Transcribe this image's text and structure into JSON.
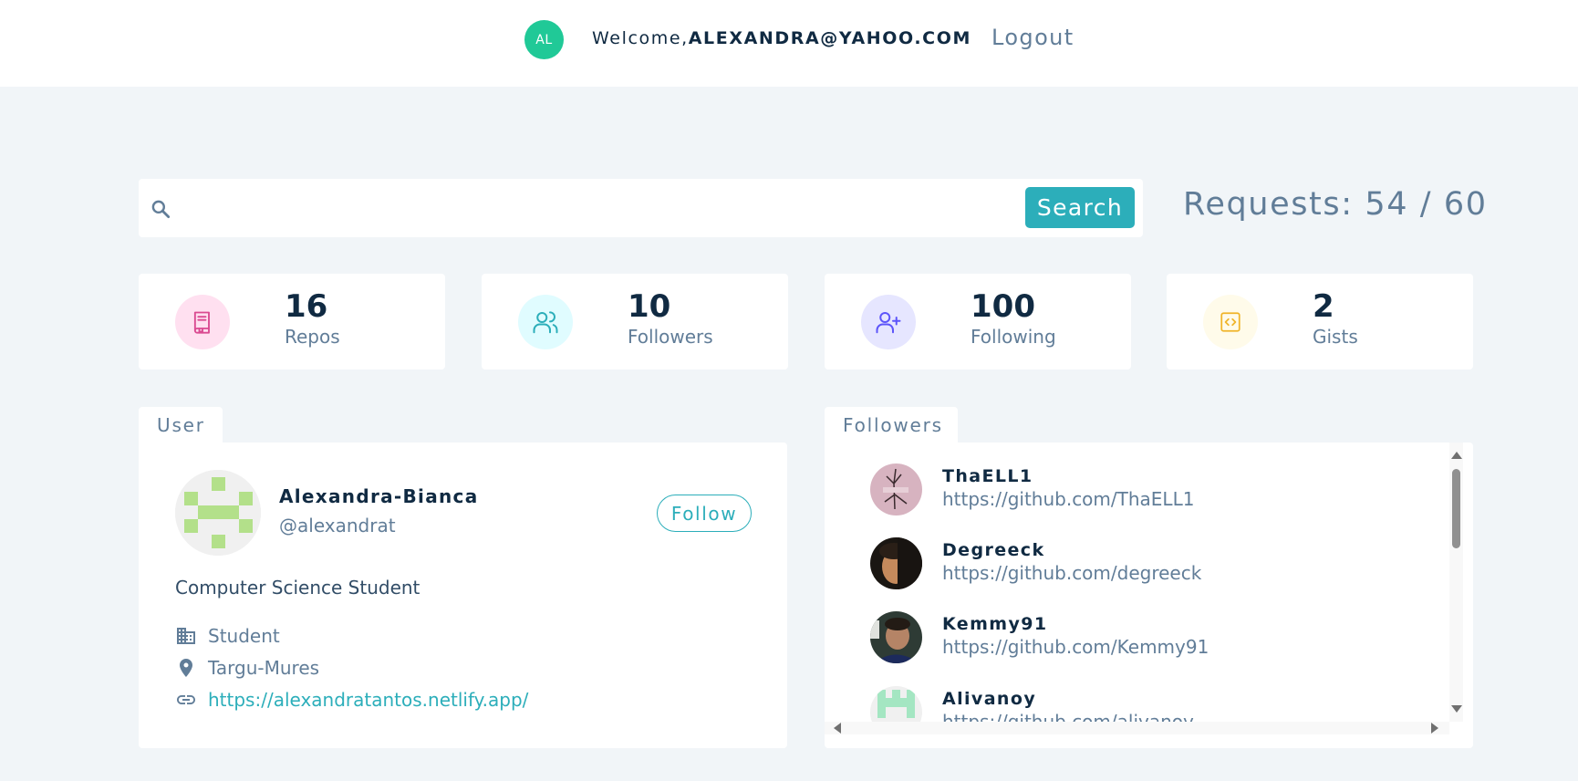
{
  "header": {
    "avatar_initials": "AL",
    "welcome_prefix": "Welcome,",
    "user_email": "ALEXANDRA@YAHOO.COM",
    "logout_label": "Logout"
  },
  "search": {
    "placeholder": "",
    "value": "",
    "button_label": "Search",
    "requests_text": "Requests: 54 / 60"
  },
  "stats": [
    {
      "value": "16",
      "label": "Repos",
      "icon": "book-icon",
      "color": "#da4a91",
      "bg": "#ffe0f0"
    },
    {
      "value": "10",
      "label": "Followers",
      "icon": "users-icon",
      "color": "#2caeba",
      "bg": "#e0fcff"
    },
    {
      "value": "100",
      "label": "Following",
      "icon": "user-plus-icon",
      "color": "#5d55fa",
      "bg": "#e6e6ff"
    },
    {
      "value": "2",
      "label": "Gists",
      "icon": "code-icon",
      "color": "#f0b429",
      "bg": "#fffbea"
    }
  ],
  "user_panel": {
    "tab_label": "User",
    "name": "Alexandra-Bianca",
    "handle": "@alexandrat",
    "follow_label": "Follow",
    "bio": "Computer Science Student",
    "company": "Student",
    "location": "Targu-Mures",
    "blog": "https://alexandratantos.netlify.app/"
  },
  "followers_panel": {
    "tab_label": "Followers",
    "items": [
      {
        "login": "ThaELL1",
        "url": "https://github.com/ThaELL1"
      },
      {
        "login": "Degreeck",
        "url": "https://github.com/degreeck"
      },
      {
        "login": "Kemmy91",
        "url": "https://github.com/Kemmy91"
      },
      {
        "login": "Alivanoy",
        "url": "https://github.com/alivanoy"
      }
    ]
  },
  "colors": {
    "primary": "#2caeba",
    "avatar_badge": "#20c997",
    "background": "#f1f5f8",
    "text_dark": "#102a42",
    "text_muted": "#617d98"
  }
}
